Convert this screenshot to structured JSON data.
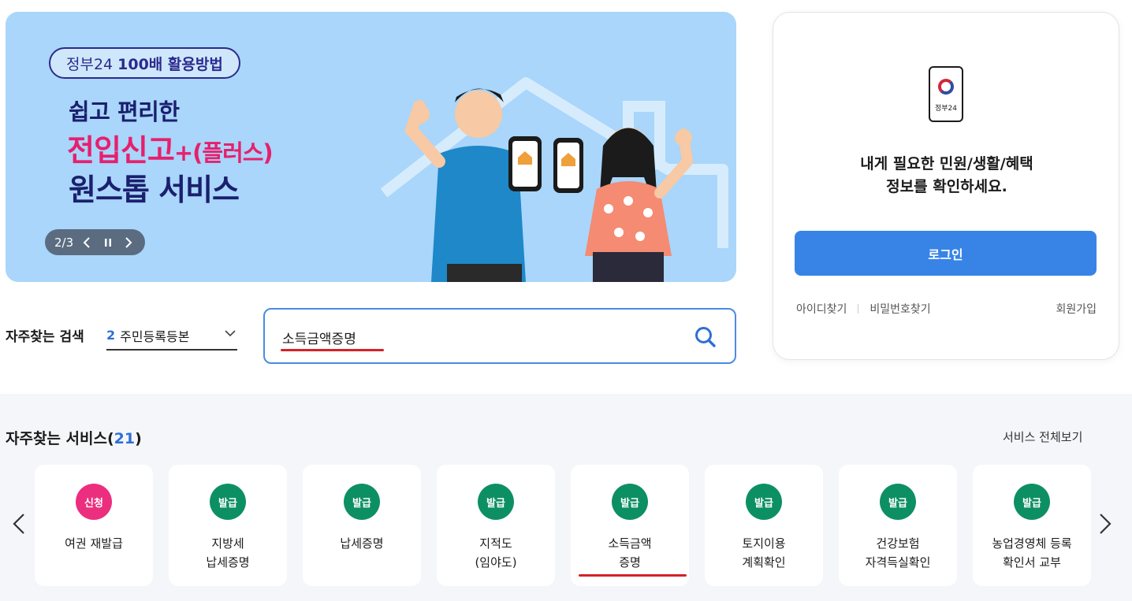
{
  "banner": {
    "tag_brand": "정부24",
    "tag_bold": "100배 활용방법",
    "line1": "쉽고 편리한",
    "line2": "전입신고",
    "line2_plus": "+(플러스)",
    "line3": "원스톱 서비스",
    "phone_label": "전입신고+",
    "pager": {
      "current": "2",
      "separator": "/",
      "total": "3"
    }
  },
  "login": {
    "logo_text": "정부24",
    "message_line1": "내게 필요한 민원/생활/혜택",
    "message_line2": "정보를 확인하세요.",
    "login_button": "로그인",
    "find_id": "아이디찾기",
    "find_password": "비밀번호찾기",
    "signup": "회원가입"
  },
  "search": {
    "frequent_label": "자주찾는 검색",
    "frequent_rank": "2",
    "frequent_term": "주민등록등본",
    "input_value": "소득금액증명"
  },
  "services": {
    "title": "자주찾는 서비스(",
    "count": "21",
    "title_close": ")",
    "view_all": "서비스 전체보기",
    "items": [
      {
        "badge": "신청",
        "badge_color": "#ec2e7e",
        "label": "여권 재발급"
      },
      {
        "badge": "발급",
        "badge_color": "#0d8f64",
        "label": "지방세\n납세증명"
      },
      {
        "badge": "발급",
        "badge_color": "#0d8f64",
        "label": "납세증명"
      },
      {
        "badge": "발급",
        "badge_color": "#0d8f64",
        "label": "지적도\n(임야도)"
      },
      {
        "badge": "발급",
        "badge_color": "#0d8f64",
        "label": "소득금액\n증명"
      },
      {
        "badge": "발급",
        "badge_color": "#0d8f64",
        "label": "토지이용\n계획확인"
      },
      {
        "badge": "발급",
        "badge_color": "#0d8f64",
        "label": "건강보험\n자격득실확인"
      },
      {
        "badge": "발급",
        "badge_color": "#0d8f64",
        "label": "농업경영체 등록\n확인서 교부"
      }
    ]
  },
  "colors": {
    "banner_bg": "#a9d6fa",
    "accent_blue": "#3784e6",
    "highlight_red": "#d42127",
    "issue_green": "#0d8f64",
    "apply_pink": "#ec2e7e"
  }
}
